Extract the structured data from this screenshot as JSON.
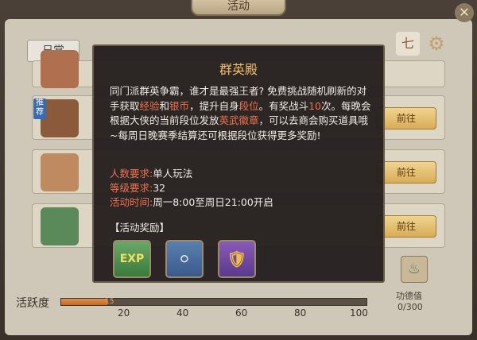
{
  "window": {
    "title": "活动",
    "close_icon": "✕"
  },
  "tabs": {
    "daily": "日常"
  },
  "list": {
    "recommend_badge": "推荐",
    "go_label": "前往"
  },
  "activity": {
    "label": "活跃度",
    "current": 15,
    "max": 100,
    "ticks": [
      "20",
      "40",
      "60",
      "80",
      "100"
    ]
  },
  "merit": {
    "label": "功德值",
    "value": "0/300"
  },
  "modal": {
    "title": "群英殿",
    "desc": {
      "p1": "同门派群英争霸，谁才是最强王者? 免费挑战随机刷新的对手获取",
      "h1": "经验",
      "p2": "和",
      "h2": "银币",
      "p3": "，提升自身",
      "h3": "段位",
      "p4": "。有奖战斗",
      "h4": "10",
      "p5": "次。每晚会根据大侠的当前段位发放",
      "h5": "英武徽章",
      "p6": "，可以去商会购买道具哦~每周日晚赛季结算还可根据段位获得更多奖励!"
    },
    "requirements": [
      {
        "key": "人数要求:",
        "value": "单人玩法"
      },
      {
        "key": "等级要求:",
        "value": "32"
      },
      {
        "key": "活动时间:",
        "value": "周一8:00至周日21:00开启"
      }
    ],
    "reward_title": "【活动奖励】",
    "rewards": [
      {
        "name": "exp-reward",
        "label": "EXP"
      },
      {
        "name": "silver-coin-reward",
        "label": "⚪"
      },
      {
        "name": "badge-reward",
        "label": "🛡"
      }
    ]
  },
  "colors": {
    "highlight": "#f07050",
    "title": "#f0c070",
    "modal_bg": "#221e1c",
    "progress": "#c06a2a"
  }
}
